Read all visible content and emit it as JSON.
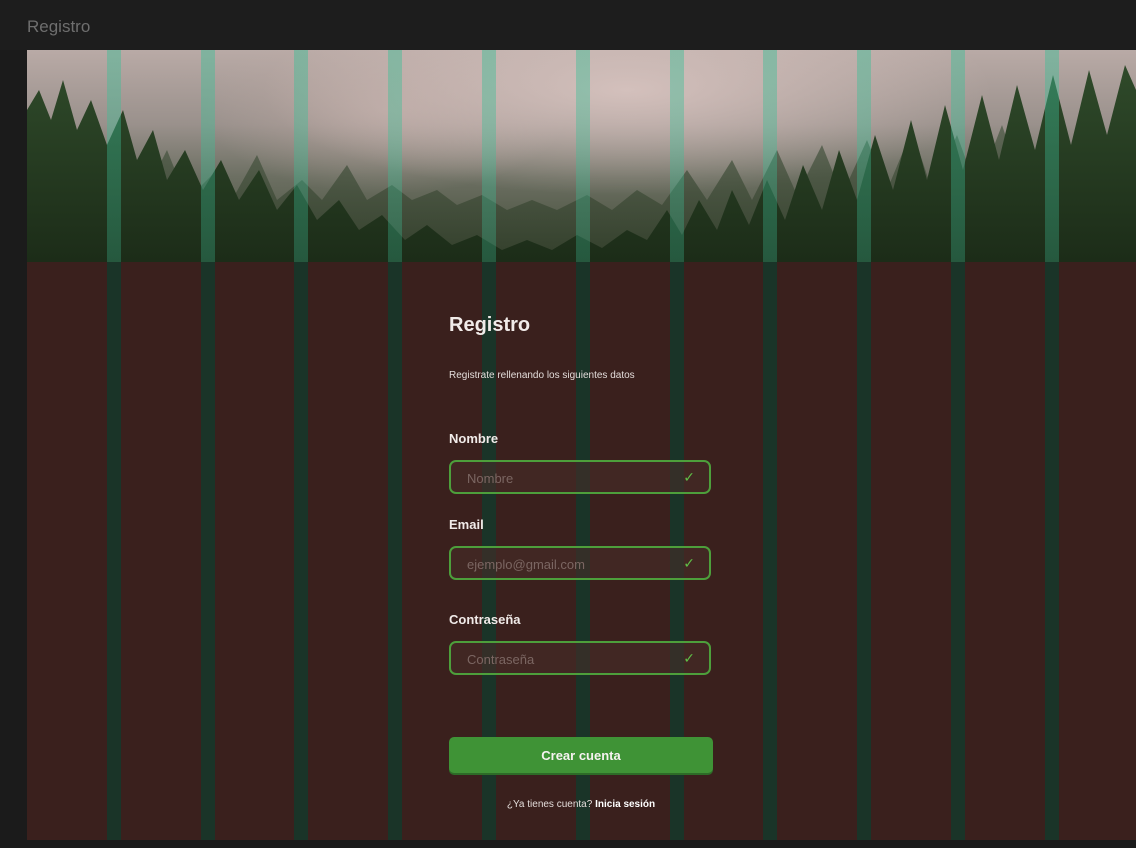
{
  "window": {
    "title": "Registro"
  },
  "form": {
    "title": "Registro",
    "subtitle": "Registrate rellenando los siguientes datos",
    "fields": [
      {
        "label": "Nombre",
        "placeholder": "Nombre",
        "icon": "check-icon"
      },
      {
        "label": "Email",
        "placeholder": "ejemplo@gmail.com",
        "icon": "check-icon"
      },
      {
        "label": "Contraseña",
        "placeholder": "Contraseña",
        "icon": "check-icon"
      }
    ],
    "submit_label": "Crear cuenta",
    "footer_text": "¿Ya tienes cuenta?",
    "footer_link": "Inicia sesión"
  },
  "colors": {
    "background": "#3a201d",
    "accent": "#3f9336",
    "field_border": "#4d9f3b",
    "column_overlay": "#14372a"
  }
}
